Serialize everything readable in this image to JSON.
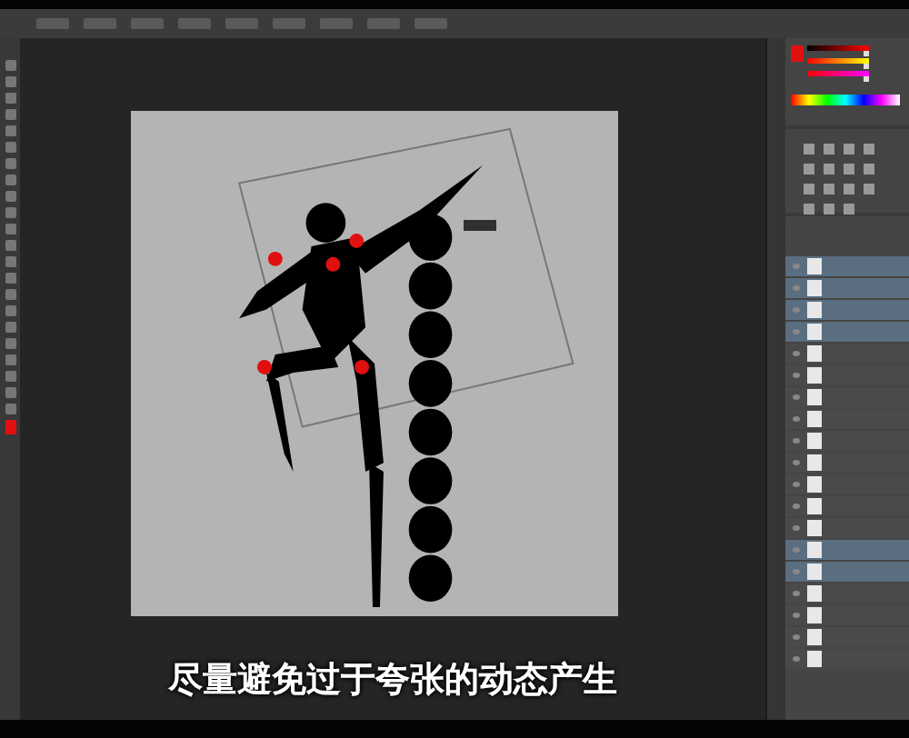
{
  "layers": [
    {
      "selected": true
    },
    {
      "selected": true
    },
    {
      "selected": true
    },
    {
      "selected": true
    },
    {
      "selected": false
    },
    {
      "selected": false
    },
    {
      "selected": false
    },
    {
      "selected": false
    },
    {
      "selected": false
    },
    {
      "selected": false
    },
    {
      "selected": false
    },
    {
      "selected": false
    },
    {
      "selected": false
    },
    {
      "selected": true
    },
    {
      "selected": true
    },
    {
      "selected": false
    },
    {
      "selected": false
    },
    {
      "selected": false
    },
    {
      "selected": false
    }
  ],
  "color_sliders": [
    {
      "level": 0.95
    },
    {
      "level": 0.95
    },
    {
      "level": 0.95
    }
  ],
  "subtitle": "尽量避免过于夸张的动态产生"
}
